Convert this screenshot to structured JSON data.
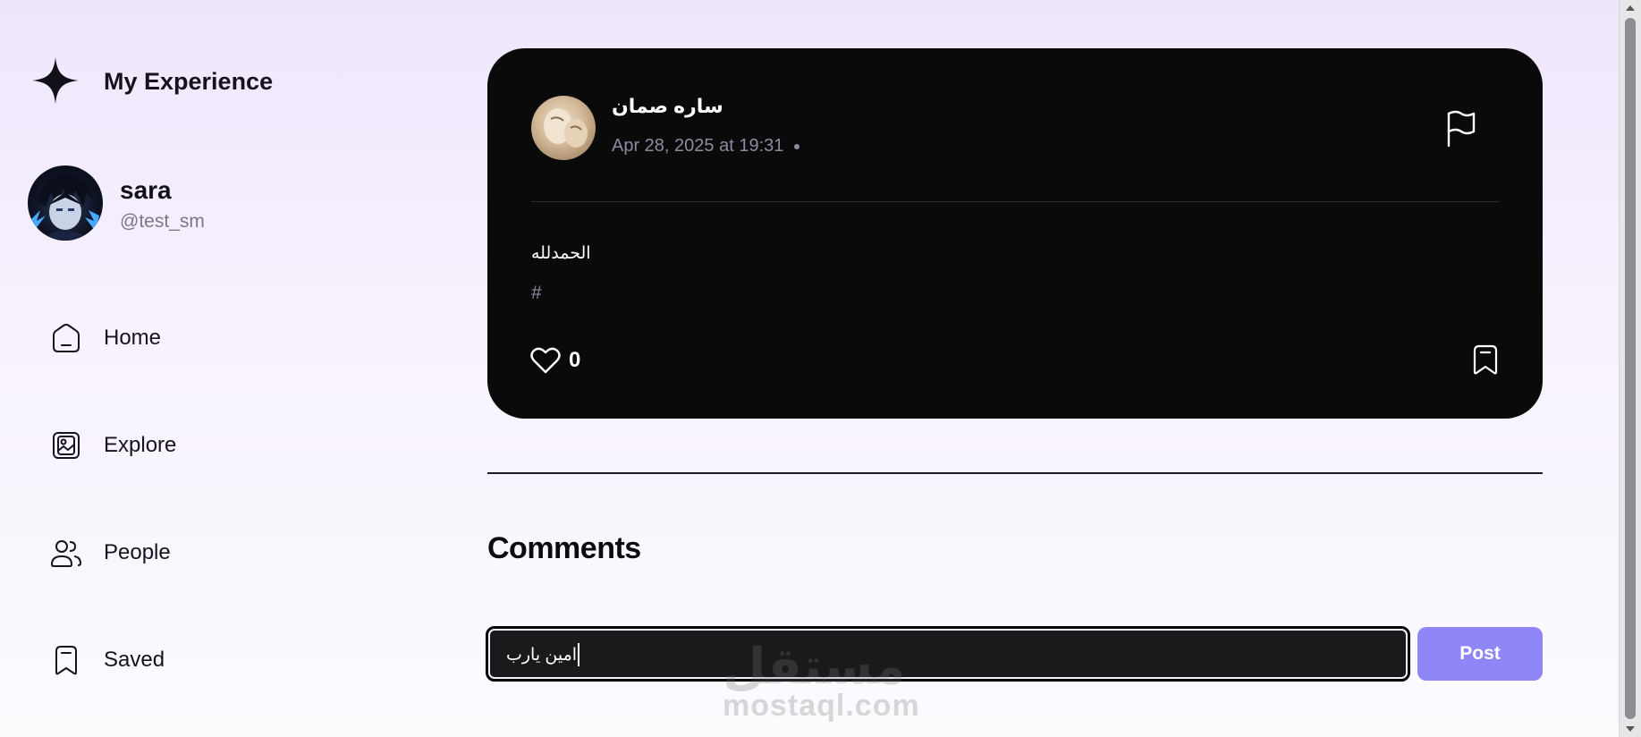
{
  "app": {
    "title": "My Experience"
  },
  "user": {
    "name": "sara",
    "handle": "@test_sm"
  },
  "nav": {
    "items": [
      {
        "label": "Home",
        "icon": "home-icon"
      },
      {
        "label": "Explore",
        "icon": "gallery-icon"
      },
      {
        "label": "People",
        "icon": "people-icon"
      },
      {
        "label": "Saved",
        "icon": "bookmark-icon"
      }
    ]
  },
  "post": {
    "author": "ساره صمان",
    "time": "Apr 28, 2025 at 19:31",
    "text": "الحمدلله",
    "tag": "#",
    "likes": "0"
  },
  "comments": {
    "title": "Comments",
    "input_value": "امين يارب",
    "post_label": "Post"
  },
  "watermark": {
    "logo": "مستقل",
    "url": "mostaql.com"
  },
  "colors": {
    "accent": "#8f86f7",
    "card": "#0a0a0a",
    "muted": "#8e8aa0"
  }
}
